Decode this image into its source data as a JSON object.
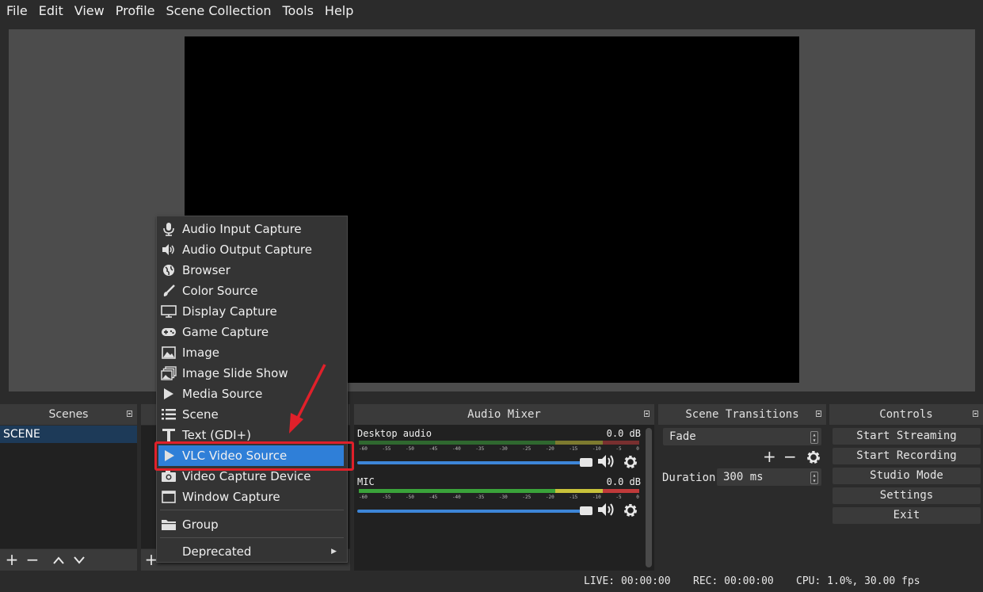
{
  "menubar": {
    "items": [
      "File",
      "Edit",
      "View",
      "Profile",
      "Scene Collection",
      "Tools",
      "Help"
    ]
  },
  "scenes": {
    "title": "Scenes",
    "items": [
      "SCENE"
    ]
  },
  "context_menu": {
    "items": [
      {
        "label": "Audio Input Capture",
        "icon": "microphone-icon"
      },
      {
        "label": "Audio Output Capture",
        "icon": "speaker-icon"
      },
      {
        "label": "Browser",
        "icon": "globe-icon"
      },
      {
        "label": "Color Source",
        "icon": "paintbrush-icon"
      },
      {
        "label": "Display Capture",
        "icon": "monitor-icon"
      },
      {
        "label": "Game Capture",
        "icon": "gamepad-icon"
      },
      {
        "label": "Image",
        "icon": "image-icon"
      },
      {
        "label": "Image Slide Show",
        "icon": "slideshow-icon"
      },
      {
        "label": "Media Source",
        "icon": "play-icon"
      },
      {
        "label": "Scene",
        "icon": "list-icon"
      },
      {
        "label": "Text (GDI+)",
        "icon": "text-icon"
      },
      {
        "label": "VLC Video Source",
        "icon": "play-icon",
        "selected": true
      },
      {
        "label": "Video Capture Device",
        "icon": "camera-icon"
      },
      {
        "label": "Window Capture",
        "icon": "window-icon"
      },
      {
        "label": "Group",
        "icon": "folder-icon"
      },
      {
        "label": "Deprecated",
        "icon": "",
        "submenu": true
      }
    ]
  },
  "mixer": {
    "title": "Audio Mixer",
    "ticks": [
      "-60",
      "-55",
      "-50",
      "-45",
      "-40",
      "-35",
      "-30",
      "-25",
      "-20",
      "-15",
      "-10",
      "-5",
      "0"
    ],
    "channels": [
      {
        "name": "Desktop audio",
        "db": "0.0 dB"
      },
      {
        "name": "MIC",
        "db": "0.0 dB"
      }
    ]
  },
  "transitions": {
    "title": "Scene Transitions",
    "selected": "Fade",
    "duration_label": "Duration",
    "duration_value": "300 ms"
  },
  "controls": {
    "title": "Controls",
    "buttons": [
      "Start Streaming",
      "Start Recording",
      "Studio Mode",
      "Settings",
      "Exit"
    ]
  },
  "status": {
    "live": "LIVE: 00:00:00",
    "rec": "REC: 00:00:00",
    "cpu": "CPU: 1.0%, 30.00 fps"
  },
  "colors": {
    "accent": "#2f7fd8",
    "highlight": "#e0202a"
  }
}
